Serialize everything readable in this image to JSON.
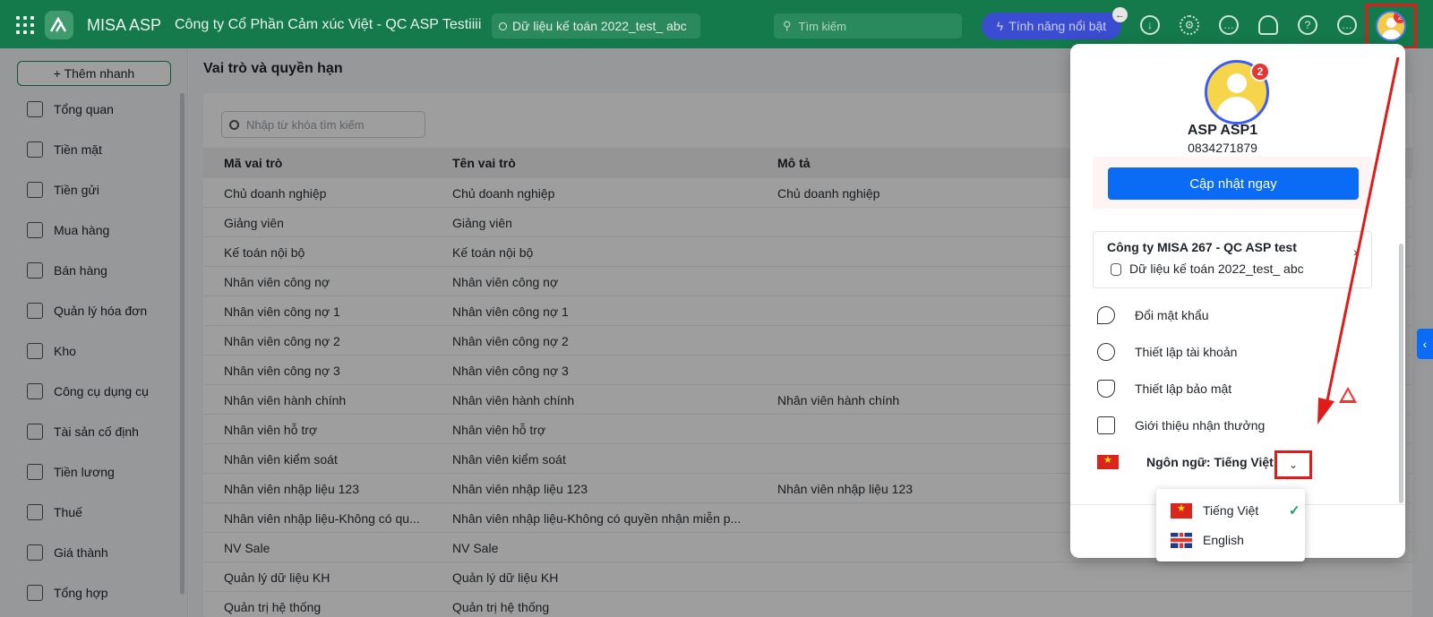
{
  "topbar": {
    "brand": "MISA ASP",
    "company": "Công ty Cổ Phần Cảm xúc Việt - QC ASP Testiiii",
    "database": "Dữ liệu kế toán 2022_test_ abc",
    "search_placeholder": "Tìm kiếm",
    "feature_label": "Tính năng nổi bật",
    "avatar_badge": "2"
  },
  "sidebar": {
    "quick_add": "+ Thêm nhanh",
    "items": [
      {
        "label": "Tổng quan"
      },
      {
        "label": "Tiền mặt"
      },
      {
        "label": "Tiền gửi"
      },
      {
        "label": "Mua hàng"
      },
      {
        "label": "Bán hàng"
      },
      {
        "label": "Quản lý hóa đơn"
      },
      {
        "label": "Kho"
      },
      {
        "label": "Công cụ dụng cụ"
      },
      {
        "label": "Tài sản cố định"
      },
      {
        "label": "Tiền lương"
      },
      {
        "label": "Thuế"
      },
      {
        "label": "Giá thành"
      },
      {
        "label": "Tổng hợp"
      }
    ]
  },
  "main": {
    "title": "Vai trò và quyền hạn",
    "search_placeholder": "Nhập từ khóa tìm kiếm",
    "columns": [
      "Mã vai trò",
      "Tên vai trò",
      "Mô tả"
    ],
    "rows": [
      [
        "Chủ doanh nghiệp",
        "Chủ doanh nghiệp",
        "Chủ doanh nghiệp"
      ],
      [
        "Giảng viên",
        "Giảng viên",
        ""
      ],
      [
        "Kế toán nội bộ",
        "Kế toán nội bộ",
        ""
      ],
      [
        "Nhân viên công nợ",
        "Nhân viên công nợ",
        ""
      ],
      [
        "Nhân viên công nợ 1",
        "Nhân viên công nợ 1",
        ""
      ],
      [
        "Nhân viên công nợ 2",
        "Nhân viên công nợ 2",
        ""
      ],
      [
        "Nhân viên công nợ 3",
        "Nhân viên công nợ 3",
        ""
      ],
      [
        "Nhân viên hành chính",
        "Nhân viên hành chính",
        "Nhân viên hành chính"
      ],
      [
        "Nhân viên hỗ trợ",
        "Nhân viên hỗ trợ",
        ""
      ],
      [
        "Nhân viên kiểm soát",
        "Nhân viên kiểm soát",
        ""
      ],
      [
        "Nhân viên nhập liệu 123",
        "Nhân viên nhập liệu 123",
        "Nhân viên nhập liệu 123"
      ],
      [
        "Nhân viên nhập liệu-Không có qu...",
        "Nhân viên nhập liệu-Không có quyền nhận miễn p...",
        ""
      ],
      [
        "NV Sale",
        "NV Sale",
        ""
      ],
      [
        "Quản lý dữ liệu KH",
        "Quản lý dữ liệu KH",
        ""
      ],
      [
        "Quản trị hệ thống",
        "Quản trị hệ thống",
        ""
      ]
    ]
  },
  "profile": {
    "name": "ASP ASP1",
    "phone": "0834271879",
    "badge": "2",
    "update_button": "Cập nhật ngay",
    "company_name": "Công ty MISA 267 - QC ASP test",
    "company_db": "Dữ liệu kế toán 2022_test_ abc",
    "menu": [
      {
        "label": "Đổi mật khẩu",
        "icon": "key-icon"
      },
      {
        "label": "Thiết lập tài khoản",
        "icon": "user-circle-icon"
      },
      {
        "label": "Thiết lập bảo mật",
        "icon": "shield-icon"
      },
      {
        "label": "Giới thiệu nhận thưởng",
        "icon": "gift-icon"
      }
    ],
    "language_label": "Ngôn ngữ: Tiếng Việt"
  },
  "language_dropdown": {
    "options": [
      {
        "label": "Tiếng Việt",
        "selected": true
      },
      {
        "label": "English",
        "selected": false
      }
    ]
  },
  "colors": {
    "topbar": "#147a4b",
    "primary": "#0a6cf5",
    "annotation": "#e11a1a"
  }
}
